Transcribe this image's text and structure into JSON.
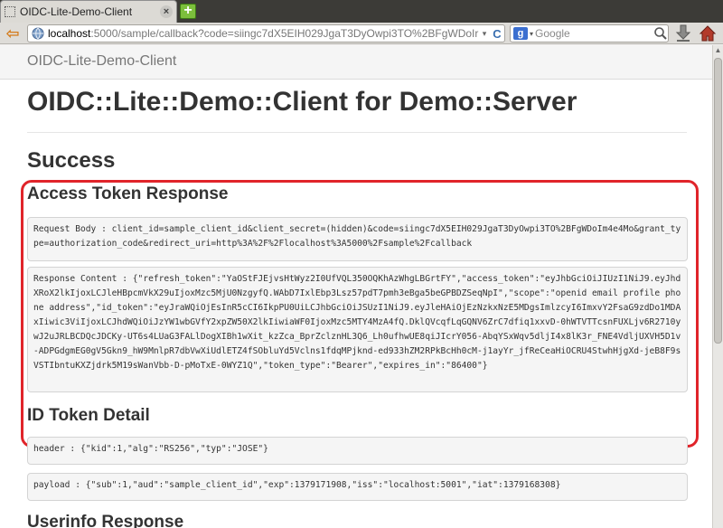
{
  "browser": {
    "tab_title": "OIDC-Lite-Demo-Client",
    "tab_close": "×",
    "newtab_label": "+",
    "back_glyph": "⇦",
    "url_host": "localhost",
    "url_rest": ":5000/sample/callback?code=siingc7dX5EIH029JgaT3DyOwpi3TO%2BFgWDoIr",
    "url_dropdown": "▾",
    "reload_glyph": "C",
    "search_engine_letter": "g",
    "search_dropdown": "▾",
    "search_placeholder": "Google"
  },
  "page": {
    "brand": "OIDC-Lite-Demo-Client",
    "title": "OIDC::Lite::Demo::Client for Demo::Server",
    "status": "Success",
    "sections": {
      "access_token_heading": "Access Token Response",
      "request_body": "Request Body : client_id=sample_client_id&client_secret=(hidden)&code=siingc7dX5EIH029JgaT3DyOwpi3TO%2BFgWDoIm4e4Mo&grant_type=authorization_code&redirect_uri=http%3A%2F%2Flocalhost%3A5000%2Fsample%2Fcallback",
      "response_content": "Response Content : {\"refresh_token\":\"YaOStFJEjvsHtWyz2I0UfVQL350OQKhAzWhgLBGrtFY\",\"access_token\":\"eyJhbGciOiJIUzI1NiJ9.eyJhdXRoX2lkIjoxLCJleHBpcmVkX29uIjoxMzc5MjU0NzgyfQ.WAbD7IxlEbp3Lsz57pdT7pmh3eBga5beGPBDZSeqNpI\",\"scope\":\"openid email profile phone address\",\"id_token\":\"eyJraWQiOjEsInR5cCI6IkpPU0UiLCJhbGciOiJSUzI1NiJ9.eyJleHAiOjEzNzkxNzE5MDgsImlzcyI6ImxvY2FsaG9zdDo1MDAxIiwic3ViIjoxLCJhdWQiOiJzYW1wbGVfY2xpZW50X2lkIiwiaWF0IjoxMzc5MTY4MzA4fQ.DklQVcqfLqGQNV6ZrC7dfiq1xxvD-0hWTVTTcsnFUXLjv6R2710ywJ2uJRLBCDQcJDCKy-UT6s4LUaG3FALlDogXIBh1wXit_kzZca_BprZclznHL3Q6_Lh0ufhwUE8qiJIcrY056-AbqYSxWqv5dljI4x8lK3r_FNE4VdljUXVH5D1v-ADPGdgmEG0gV5Gkn9_hW9MnlpR7dbVwXiUdlETZ4fSObluYd5Vclns1fdqMPjknd-ed933hZM2RPkBcHh0cM-j1ayYr_jfReCeaHiOCRU4StwhHjgXd-jeB8F9sVSTIbntuKXZjdrk5M19sWanVbb-D-pMoTxE-0WYZ1Q\",\"token_type\":\"Bearer\",\"expires_in\":\"86400\"}",
      "id_token_heading": "ID Token Detail",
      "header": "header : {\"kid\":1,\"alg\":\"RS256\",\"typ\":\"JOSE\"}",
      "payload": "payload : {\"sub\":1,\"aud\":\"sample_client_id\",\"exp\":1379171908,\"iss\":\"localhost:5001\",\"iat\":1379168308}",
      "userinfo_heading": "Userinfo Response"
    }
  },
  "colors": {
    "highlight": "#e0242a",
    "page_bg": "#ffffff",
    "pre_bg": "#f5f5f5"
  },
  "icons": [
    "page-favicon-icon",
    "close-icon",
    "plus-icon",
    "back-arrow-icon",
    "site-globe-icon",
    "reload-icon",
    "google-icon",
    "search-icon",
    "download-icon",
    "home-icon"
  ]
}
